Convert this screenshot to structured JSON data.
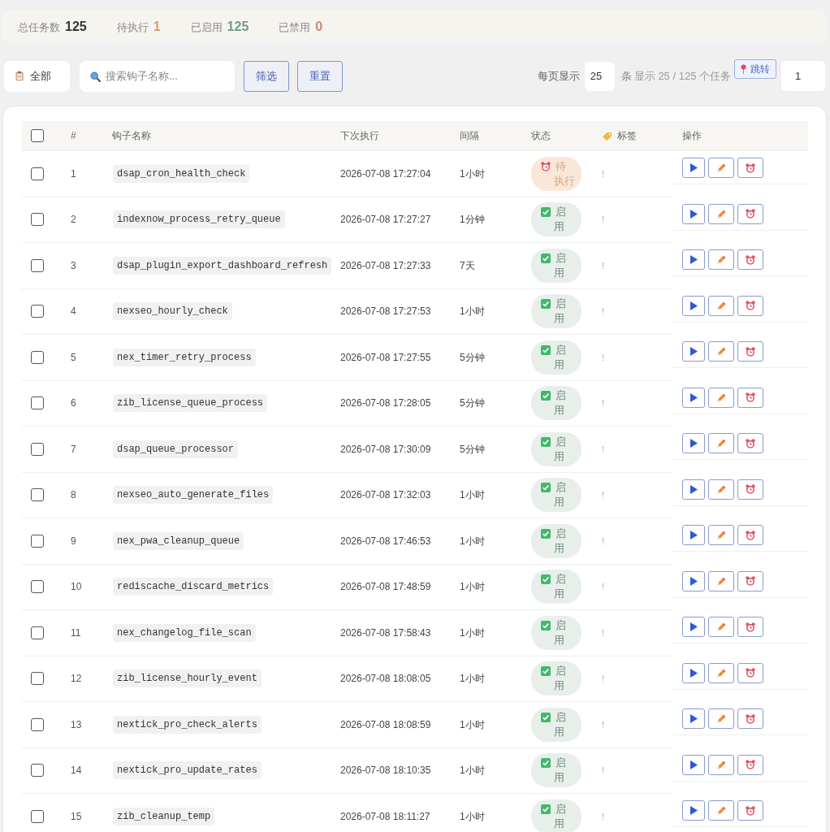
{
  "stats": [
    {
      "kind": "total",
      "label": "总任务数",
      "value": "125"
    },
    {
      "kind": "pending",
      "label": "待执行",
      "value": "1"
    },
    {
      "kind": "enabled",
      "label": "已启用",
      "value": "125"
    },
    {
      "kind": "disabled",
      "label": "已禁用",
      "value": "0"
    }
  ],
  "toolbar": {
    "scope": {
      "label": "全部"
    },
    "search": {
      "placeholder": "搜索钩子名称..."
    },
    "buttons": [
      "筛选",
      "重置"
    ],
    "per_page": {
      "label": "每页显示",
      "value": "25",
      "unit": "条"
    },
    "summary": "显示 25 / 125 个任务",
    "jump": {
      "label": "跳转",
      "value": "1"
    }
  },
  "table": {
    "select_all": {
      "checked": false
    },
    "columns": [
      "#",
      "钩子名称",
      "下次执行",
      "间隔",
      "状态",
      "标签",
      "操作"
    ],
    "rows": [
      {
        "checked": false,
        "index": "1",
        "hook": "dsap_cron_health_check",
        "next_run": "2026-07-08 17:27:04",
        "interval": "1小时",
        "status": {
          "kind": "pending",
          "label": "待执行"
        },
        "tag": "!"
      },
      {
        "checked": false,
        "index": "2",
        "hook": "indexnow_process_retry_queue",
        "next_run": "2026-07-08 17:27:27",
        "interval": "1分钟",
        "status": {
          "kind": "enabled",
          "label": "启用"
        },
        "tag": "!"
      },
      {
        "checked": false,
        "index": "3",
        "hook": "dsap_plugin_export_dashboard_refresh",
        "next_run": "2026-07-08 17:27:33",
        "interval": "7天",
        "status": {
          "kind": "enabled",
          "label": "启用"
        },
        "tag": "!"
      },
      {
        "checked": false,
        "index": "4",
        "hook": "nexseo_hourly_check",
        "next_run": "2026-07-08 17:27:53",
        "interval": "1小时",
        "status": {
          "kind": "enabled",
          "label": "启用"
        },
        "tag": "!"
      },
      {
        "checked": false,
        "index": "5",
        "hook": "nex_timer_retry_process",
        "next_run": "2026-07-08 17:27:55",
        "interval": "5分钟",
        "status": {
          "kind": "enabled",
          "label": "启用"
        },
        "tag": "!"
      },
      {
        "checked": false,
        "index": "6",
        "hook": "zib_license_queue_process",
        "next_run": "2026-07-08 17:28:05",
        "interval": "5分钟",
        "status": {
          "kind": "enabled",
          "label": "启用"
        },
        "tag": "!"
      },
      {
        "checked": false,
        "index": "7",
        "hook": "dsap_queue_processor",
        "next_run": "2026-07-08 17:30:09",
        "interval": "5分钟",
        "status": {
          "kind": "enabled",
          "label": "启用"
        },
        "tag": "!"
      },
      {
        "checked": false,
        "index": "8",
        "hook": "nexseo_auto_generate_files",
        "next_run": "2026-07-08 17:32:03",
        "interval": "1小时",
        "status": {
          "kind": "enabled",
          "label": "启用"
        },
        "tag": "!"
      },
      {
        "checked": false,
        "index": "9",
        "hook": "nex_pwa_cleanup_queue",
        "next_run": "2026-07-08 17:46:53",
        "interval": "1小时",
        "status": {
          "kind": "enabled",
          "label": "启用"
        },
        "tag": "!"
      },
      {
        "checked": false,
        "index": "10",
        "hook": "rediscache_discard_metrics",
        "next_run": "2026-07-08 17:48:59",
        "interval": "1小时",
        "status": {
          "kind": "enabled",
          "label": "启用"
        },
        "tag": "!"
      },
      {
        "checked": false,
        "index": "11",
        "hook": "nex_changelog_file_scan",
        "next_run": "2026-07-08 17:58:43",
        "interval": "1小时",
        "status": {
          "kind": "enabled",
          "label": "启用"
        },
        "tag": "!"
      },
      {
        "checked": false,
        "index": "12",
        "hook": "zib_license_hourly_event",
        "next_run": "2026-07-08 18:08:05",
        "interval": "1小时",
        "status": {
          "kind": "enabled",
          "label": "启用"
        },
        "tag": "!"
      },
      {
        "checked": false,
        "index": "13",
        "hook": "nextick_pro_check_alerts",
        "next_run": "2026-07-08 18:08:59",
        "interval": "1小时",
        "status": {
          "kind": "enabled",
          "label": "启用"
        },
        "tag": "!"
      },
      {
        "checked": false,
        "index": "14",
        "hook": "nextick_pro_update_rates",
        "next_run": "2026-07-08 18:10:35",
        "interval": "1小时",
        "status": {
          "kind": "enabled",
          "label": "启用"
        },
        "tag": "!"
      },
      {
        "checked": false,
        "index": "15",
        "hook": "zib_cleanup_temp",
        "next_run": "2026-07-08 18:11:27",
        "interval": "1小时",
        "status": {
          "kind": "enabled",
          "label": "启用"
        },
        "tag": "!"
      }
    ]
  }
}
